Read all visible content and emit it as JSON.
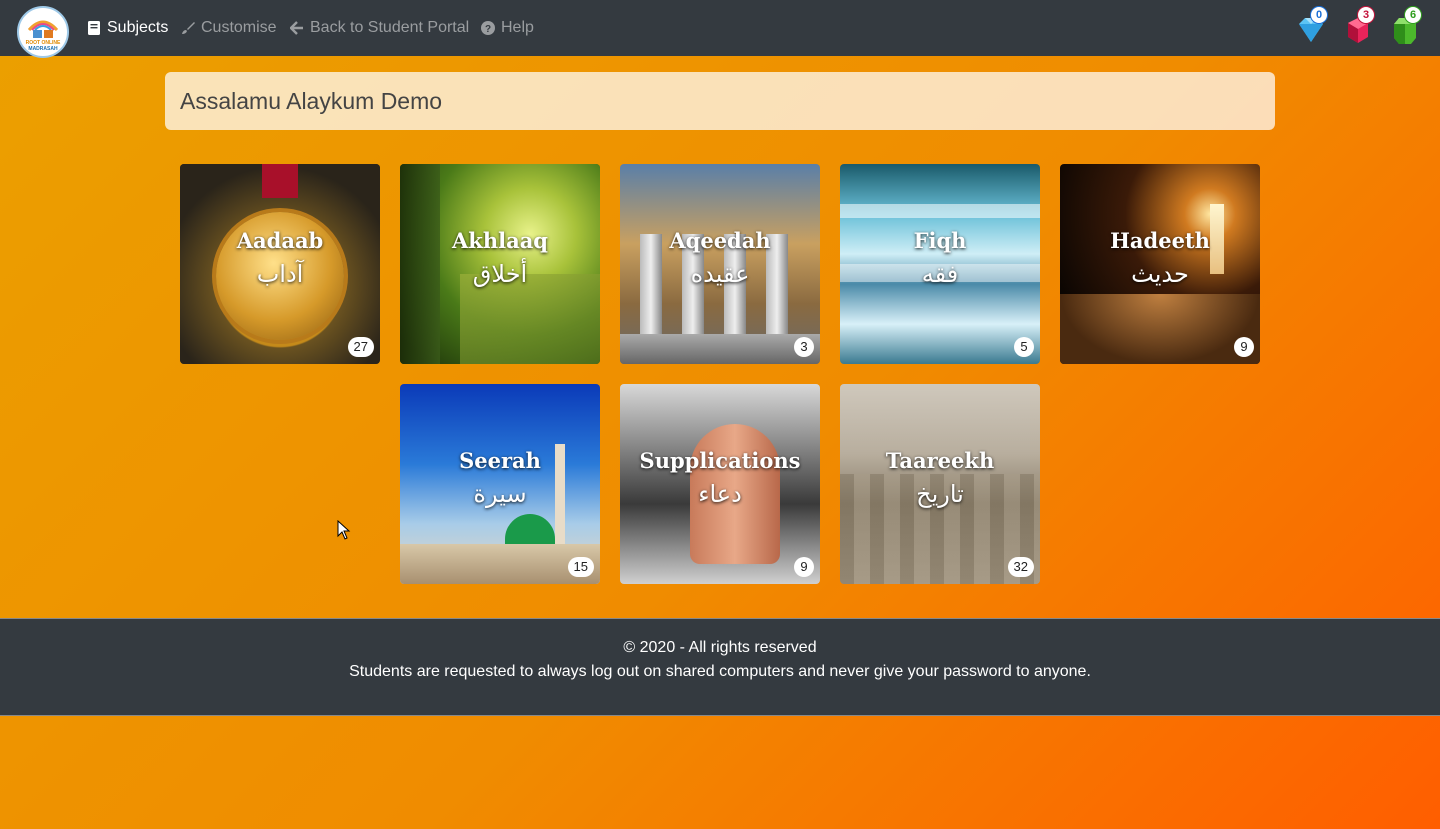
{
  "navbar": {
    "logo_line1": "ROOT ONLINE",
    "logo_line2": "MADRASAH",
    "items": [
      {
        "label": "Subjects",
        "icon": "book-icon",
        "active": true
      },
      {
        "label": "Customise",
        "icon": "paintbrush-icon",
        "active": false
      },
      {
        "label": "Back to Student Portal",
        "icon": "arrow-left-icon",
        "active": false
      },
      {
        "label": "Help",
        "icon": "question-circle-icon",
        "active": false
      }
    ],
    "gems": [
      {
        "icon": "diamond-icon",
        "count": "0",
        "color": "#4fb8f0",
        "badge_color": "#1a6fd8"
      },
      {
        "icon": "ruby-icon",
        "count": "3",
        "color": "#e8245a",
        "badge_color": "#c4143c"
      },
      {
        "icon": "emerald-icon",
        "count": "6",
        "color": "#5cc83c",
        "badge_color": "#2f9e1e"
      }
    ]
  },
  "greeting": "Assalamu Alaykum Demo",
  "subjects": [
    {
      "name": "Aadaab",
      "arabic": "آداب",
      "count": "27"
    },
    {
      "name": "Akhlaaq",
      "arabic": "أخلاق",
      "count": ""
    },
    {
      "name": "Aqeedah",
      "arabic": "عقيده",
      "count": "3"
    },
    {
      "name": "Fiqh",
      "arabic": "فقه",
      "count": "5"
    },
    {
      "name": "Hadeeth",
      "arabic": "حديث",
      "count": "9"
    },
    {
      "name": "Seerah",
      "arabic": "سيرة",
      "count": "15"
    },
    {
      "name": "Supplications",
      "arabic": "دعاء",
      "count": "9"
    },
    {
      "name": "Taareekh",
      "arabic": "تاريخ",
      "count": "32"
    }
  ],
  "footer": {
    "copyright": "© 2020 - All rights reserved",
    "notice": "Students are requested to always log out on shared computers and never give your password to anyone."
  }
}
